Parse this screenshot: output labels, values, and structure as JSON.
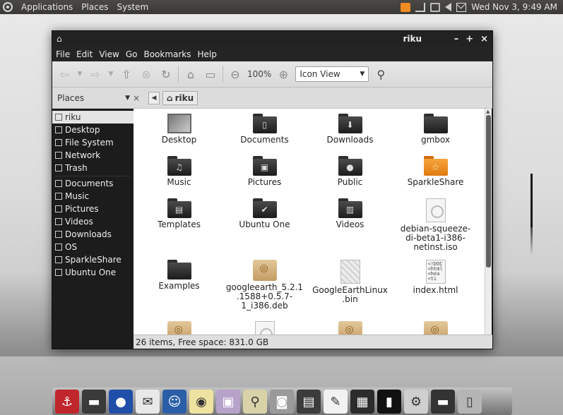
{
  "top_panel": {
    "menus": [
      "Applications",
      "Places",
      "System"
    ],
    "clock": "Wed Nov 3, 9:49 AM"
  },
  "window": {
    "title": "riku",
    "menubar": [
      "File",
      "Edit",
      "View",
      "Go",
      "Bookmarks",
      "Help"
    ],
    "toolbar": {
      "zoom": "100%",
      "view_mode": "Icon View"
    },
    "pathbar": {
      "pane_label": "Places",
      "crumb": "riku"
    },
    "sidebar": {
      "items": [
        {
          "label": "riku",
          "icon": "home-icon",
          "selected": true
        },
        {
          "label": "Desktop",
          "icon": "desktop-icon"
        },
        {
          "label": "File System",
          "icon": "drive-icon"
        },
        {
          "label": "Network",
          "icon": "network-icon"
        },
        {
          "label": "Trash",
          "icon": "trash-icon"
        }
      ],
      "bookmarks": [
        {
          "label": "Documents",
          "icon": "folder-icon"
        },
        {
          "label": "Music",
          "icon": "music-icon"
        },
        {
          "label": "Pictures",
          "icon": "pictures-icon"
        },
        {
          "label": "Videos",
          "icon": "videos-icon"
        },
        {
          "label": "Downloads",
          "icon": "downloads-icon"
        },
        {
          "label": "OS",
          "icon": "folder-icon"
        },
        {
          "label": "SparkleShare",
          "icon": "folder-icon"
        },
        {
          "label": "Ubuntu One",
          "icon": "folder-icon"
        }
      ]
    },
    "files": [
      {
        "name": "Desktop",
        "kind": "desktop"
      },
      {
        "name": "Documents",
        "kind": "folder",
        "glyph": "▯"
      },
      {
        "name": "Downloads",
        "kind": "folder",
        "glyph": "⬇"
      },
      {
        "name": "gmbox",
        "kind": "folder",
        "glyph": ""
      },
      {
        "name": "Music",
        "kind": "folder",
        "glyph": "♫"
      },
      {
        "name": "Pictures",
        "kind": "folder",
        "glyph": "▣"
      },
      {
        "name": "Public",
        "kind": "folder",
        "glyph": "●"
      },
      {
        "name": "SparkleShare",
        "kind": "folder-orange",
        "glyph": "☆"
      },
      {
        "name": "Templates",
        "kind": "folder",
        "glyph": "▤"
      },
      {
        "name": "Ubuntu One",
        "kind": "folder",
        "glyph": "✔"
      },
      {
        "name": "Videos",
        "kind": "folder",
        "glyph": "▥"
      },
      {
        "name": "debian-squeeze-di-beta1-i386-netinst.iso",
        "kind": "disc"
      },
      {
        "name": "Examples",
        "kind": "folder",
        "glyph": ""
      },
      {
        "name": "googleearth_5.2.1.1588+0.5.7-1_i386.deb",
        "kind": "package"
      },
      {
        "name": "GoogleEarthLinux.bin",
        "kind": "binary"
      },
      {
        "name": "index.html",
        "kind": "html"
      },
      {
        "name": "",
        "kind": "package"
      },
      {
        "name": "",
        "kind": "disc"
      },
      {
        "name": "",
        "kind": "package"
      },
      {
        "name": "",
        "kind": "package"
      }
    ],
    "status": "26 items, Free space: 831.0 GB"
  },
  "dock": {
    "apps": [
      "anchor-icon",
      "folder-icon",
      "firefox-icon",
      "mail-icon",
      "empathy-icon",
      "speaker-icon",
      "imageviewer-icon",
      "search-icon",
      "camera-icon",
      "scanner-icon",
      "texteditor-icon",
      "calculator-icon",
      "terminal-icon",
      "settings-icon",
      "folder-icon",
      "trash-icon"
    ]
  }
}
